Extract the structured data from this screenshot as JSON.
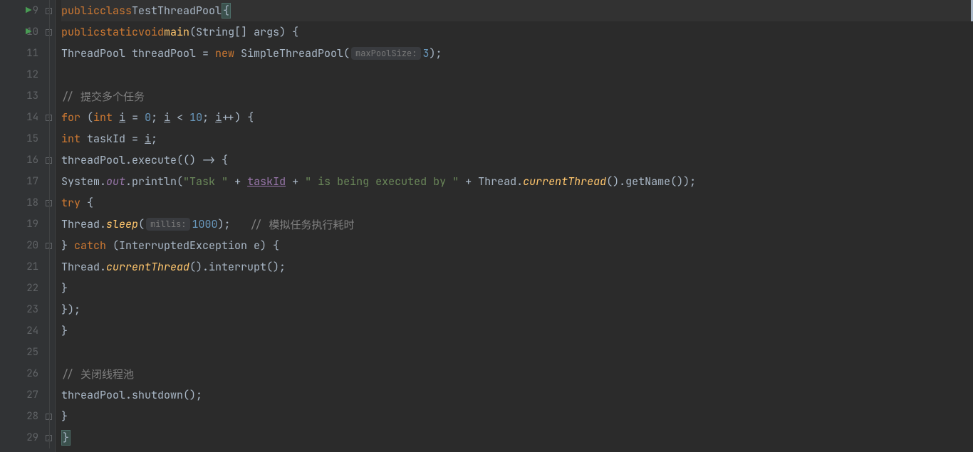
{
  "lines": [
    {
      "num": 9,
      "run": true,
      "fold": "minus"
    },
    {
      "num": 10,
      "run": true,
      "fold": "minus"
    },
    {
      "num": 11,
      "run": false,
      "fold": ""
    },
    {
      "num": 12,
      "run": false,
      "fold": ""
    },
    {
      "num": 13,
      "run": false,
      "fold": ""
    },
    {
      "num": 14,
      "run": false,
      "fold": "minus"
    },
    {
      "num": 15,
      "run": false,
      "fold": ""
    },
    {
      "num": 16,
      "run": false,
      "fold": "minus"
    },
    {
      "num": 17,
      "run": false,
      "fold": ""
    },
    {
      "num": 18,
      "run": false,
      "fold": "minus"
    },
    {
      "num": 19,
      "run": false,
      "fold": ""
    },
    {
      "num": 20,
      "run": false,
      "fold": "end"
    },
    {
      "num": 21,
      "run": false,
      "fold": ""
    },
    {
      "num": 22,
      "run": false,
      "fold": ""
    },
    {
      "num": 23,
      "run": false,
      "fold": ""
    },
    {
      "num": 24,
      "run": false,
      "fold": ""
    },
    {
      "num": 25,
      "run": false,
      "fold": ""
    },
    {
      "num": 26,
      "run": false,
      "fold": ""
    },
    {
      "num": 27,
      "run": false,
      "fold": ""
    },
    {
      "num": 28,
      "run": false,
      "fold": "end"
    },
    {
      "num": 29,
      "run": false,
      "fold": "end"
    }
  ],
  "code": {
    "l9": {
      "kw1": "public",
      "kw2": "class",
      "name": "TestThreadPool",
      "brace": "{"
    },
    "l10": {
      "kw1": "public",
      "kw2": "static",
      "kw3": "void",
      "method": "main",
      "params": "(String[] args) {"
    },
    "l11": {
      "type1": "ThreadPool threadPool = ",
      "kw": "new",
      "type2": " SimpleThreadPool(",
      "hint": "maxPoolSize:",
      "num": "3",
      "end": ");"
    },
    "l13": {
      "comment": "// 提交多个任务"
    },
    "l14": {
      "kw1": "for",
      "p1": " (",
      "kw2": "int",
      "sp": " ",
      "var1": "i",
      "eq": " = ",
      "num1": "0",
      "semi1": "; ",
      "var2": "i",
      "lt": " < ",
      "num2": "10",
      "semi2": "; ",
      "var3": "i",
      "inc": "++) {"
    },
    "l15": {
      "kw": "int",
      "var": " taskId = ",
      "varref": "i",
      "end": ";"
    },
    "l16": {
      "call": "threadPool.execute(() -> {"
    },
    "l17": {
      "p1": "System.",
      "field": "out",
      "p2": ".println(",
      "str1": "\"Task \"",
      "plus1": " + ",
      "var": "taskId",
      "plus2": " + ",
      "str2": "\" is being executed by \"",
      "plus3": " + Thread.",
      "method": "currentThread",
      "end": "().getName());"
    },
    "l18": {
      "kw": "try",
      "brace": " {"
    },
    "l19": {
      "p1": "Thread.",
      "method": "sleep",
      "p2": "(",
      "hint": "millis:",
      "num": "1000",
      "end": ");   ",
      "comment": "// 模拟任务执行耗时"
    },
    "l20": {
      "brace": "} ",
      "kw": "catch",
      "params": " (InterruptedException e) {"
    },
    "l21": {
      "p1": "Thread.",
      "method": "currentThread",
      "end": "().interrupt();"
    },
    "l22": {
      "brace": "}"
    },
    "l23": {
      "end": "});"
    },
    "l24": {
      "brace": "}"
    },
    "l26": {
      "comment": "// 关闭线程池"
    },
    "l27": {
      "call": "threadPool.shutdown();"
    },
    "l28": {
      "brace": "}"
    },
    "l29": {
      "brace": "}"
    }
  }
}
